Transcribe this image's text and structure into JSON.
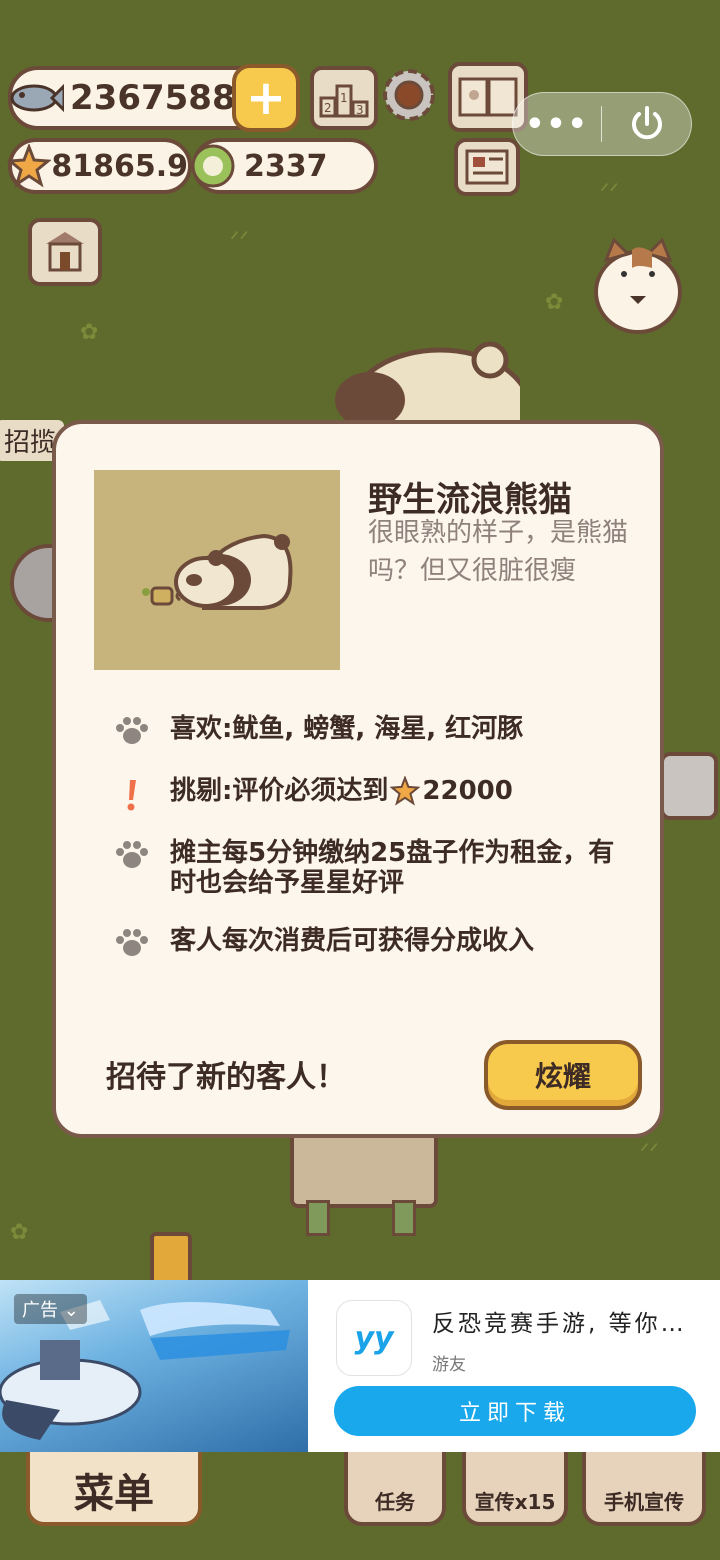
{
  "hud": {
    "fish_count": "2367588",
    "star_count": "81865.9",
    "plate_count": "2337"
  },
  "side_label": "招揽",
  "capsule": {
    "more": "•••"
  },
  "modal": {
    "title": "野生流浪熊猫",
    "description": "很眼熟的样子，是熊猫吗？但又很脏很瘦",
    "features": [
      {
        "icon": "paw-icon",
        "text": "喜欢:鱿鱼, 螃蟹, 海星, 红河豚"
      },
      {
        "icon": "exclamation-icon",
        "text": "挑剔:评价必须达到",
        "value": "22000"
      },
      {
        "icon": "paw-icon",
        "text": "摊主每5分钟缴纳25盘子作为租金，有时也会给予星星好评"
      },
      {
        "icon": "paw-icon",
        "text": "客人每次消费后可获得分成收入"
      }
    ],
    "footer_text": "招待了新的客人！",
    "show_button": "炫耀"
  },
  "ad": {
    "tag": "广告",
    "title": "反恐竞赛手游, 等你…",
    "subtitle": "游友",
    "button": "立即下载",
    "app_icon_text": "yy"
  },
  "bottom": {
    "menu": "菜单",
    "task": "任务",
    "promote": "宣传x15",
    "phone_promote": "手机宣传"
  },
  "colors": {
    "background": "#5f6b2c",
    "modal_bg": "#fdf6ec",
    "accent_yellow": "#f7c94d",
    "ad_blue": "#1aa8ec"
  }
}
